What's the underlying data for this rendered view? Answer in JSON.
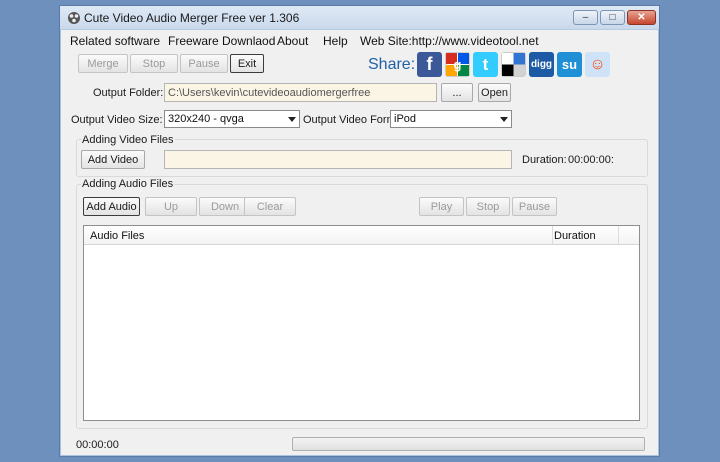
{
  "window": {
    "title": "Cute Video Audio Merger Free  ver 1.306",
    "minimize_glyph": "–",
    "maximize_glyph": "□",
    "close_glyph": "✕"
  },
  "menu": {
    "items": [
      "Related software",
      "Freeware Downlaod",
      "About",
      "Help",
      "Web Site:http://www.videotool.net"
    ]
  },
  "toolbar": {
    "merge": "Merge",
    "stop": "Stop",
    "pause": "Pause",
    "exit": "Exit"
  },
  "share": {
    "label": "Share:",
    "icons": [
      "facebook-icon",
      "google-icon",
      "twitter-icon",
      "delicious-icon",
      "digg-icon",
      "stumbleupon-icon",
      "reddit-icon"
    ],
    "digg_text": "digg",
    "facebook_glyph": "f",
    "google_glyph": "g",
    "twitter_glyph": "t",
    "stumbleupon_glyph": "su",
    "reddit_glyph": "☺"
  },
  "output": {
    "folder_label": "Output Folder:",
    "folder_value": "C:\\Users\\kevin\\cutevideoaudiomergerfree",
    "browse": "...",
    "open": "Open",
    "size_label": "Output Video Size:",
    "size_value": "320x240 - qvga",
    "format_label": "Output Video Format:",
    "format_value": "iPod"
  },
  "video": {
    "group_title": "Adding Video Files",
    "add_button": "Add Video",
    "file_value": "",
    "duration_label": "Duration:",
    "duration_value": "00:00:00:"
  },
  "audio": {
    "group_title": "Adding Audio Files",
    "add_button": "Add Audio",
    "up": "Up",
    "down": "Down",
    "clear": "Clear",
    "play": "Play",
    "stop": "Stop",
    "pause": "Pause",
    "columns": [
      "Audio Files",
      "Duration"
    ]
  },
  "status": {
    "time": "00:00:00",
    "progress": 0
  },
  "colors": {
    "facebook": "#3b5998",
    "twitter": "#33ccff",
    "digg": "#1d5aa6",
    "stumbleupon": "#1f8fd6",
    "share_text": "#1f5fa8"
  }
}
